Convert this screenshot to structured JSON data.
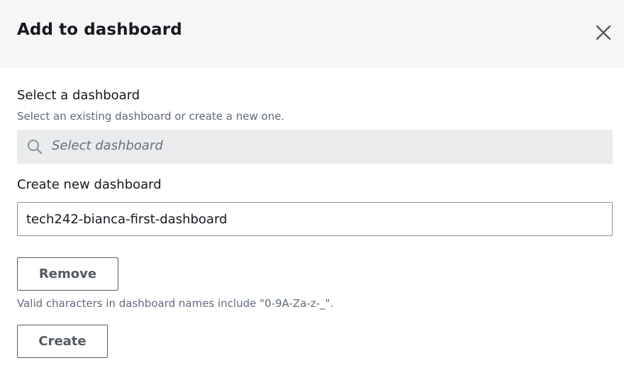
{
  "modal": {
    "title": "Add to dashboard",
    "close_icon": "close-icon"
  },
  "select_section": {
    "label": "Select a dashboard",
    "description": "Select an existing dashboard or create a new one.",
    "placeholder": "Select dashboard",
    "icon": "search-icon"
  },
  "create_section": {
    "label": "Create new dashboard",
    "input_value": "tech242-bianca-first-dashboard",
    "remove_label": "Remove",
    "validation_hint": "Valid characters in dashboard names include \"0-9A-Za-z-_\".",
    "create_label": "Create"
  }
}
